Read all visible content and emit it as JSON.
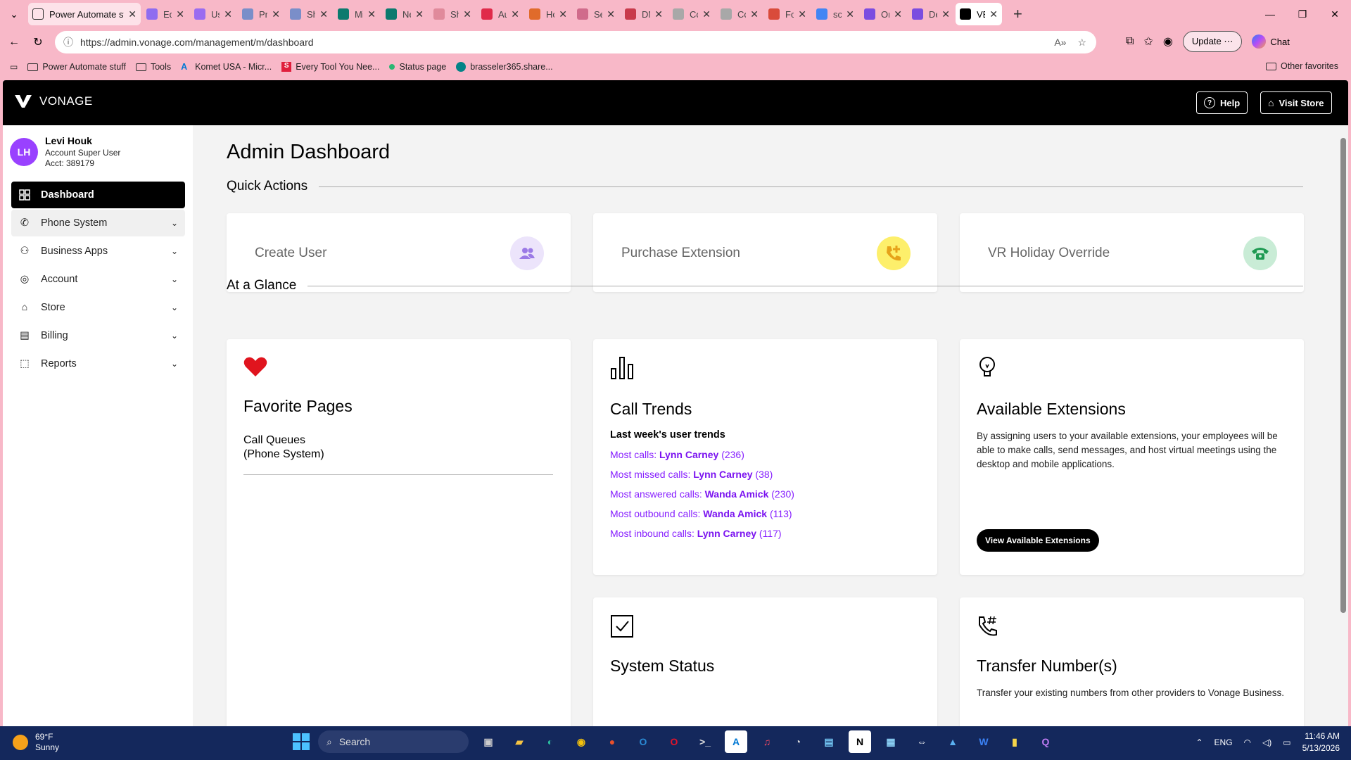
{
  "browser": {
    "tabs": [
      {
        "label": "Power Automate stuff",
        "color": "#ffffff"
      },
      {
        "label": "Edit",
        "color": "#8f6cf0"
      },
      {
        "label": "User",
        "color": "#9a6cf0"
      },
      {
        "label": "Pron",
        "color": "#7a8ec9"
      },
      {
        "label": "Shar",
        "color": "#7a8ec9"
      },
      {
        "label": "Micr",
        "color": "#0b7a6e"
      },
      {
        "label": "New",
        "color": "#0b7a6e"
      },
      {
        "label": "Shar",
        "color": "#e08a9b"
      },
      {
        "label": "Auto",
        "color": "#e02b4a"
      },
      {
        "label": "Hou",
        "color": "#e06b2b"
      },
      {
        "label": "Serv",
        "color": "#d06b8b"
      },
      {
        "label": "DM-",
        "color": "#c83a4b"
      },
      {
        "label": "Cont",
        "color": "#a8a8a8"
      },
      {
        "label": "Cont",
        "color": "#a8a8a8"
      },
      {
        "label": "Forti",
        "color": "#d94b3b"
      },
      {
        "label": "scrib",
        "color": "#4285f4"
      },
      {
        "label": "Onb",
        "color": "#7b4ce0"
      },
      {
        "label": "Desk",
        "color": "#7b4ce0"
      },
      {
        "label": "VBC",
        "color": "#000000"
      }
    ],
    "url": "https://admin.vonage.com/management/m/dashboard",
    "update_label": "Update",
    "chat_label": "Chat",
    "bookmarks": [
      "Power Automate stuff",
      "Tools",
      "Komet USA - Micr...",
      "Every Tool You Nee...",
      "Status page",
      "brasseler365.share..."
    ],
    "other_favorites": "Other favorites"
  },
  "header": {
    "brand": "VONAGE",
    "help_label": "Help",
    "store_label": "Visit Store"
  },
  "user": {
    "initials": "LH",
    "name": "Levi Houk",
    "role": "Account Super User",
    "account": "Acct: 389179"
  },
  "sidebar": {
    "items": [
      {
        "label": "Dashboard"
      },
      {
        "label": "Phone System"
      },
      {
        "label": "Business Apps"
      },
      {
        "label": "Account"
      },
      {
        "label": "Store"
      },
      {
        "label": "Billing"
      },
      {
        "label": "Reports"
      }
    ]
  },
  "main": {
    "title": "Admin Dashboard",
    "quick_actions_title": "Quick Actions",
    "quick_actions": [
      {
        "label": "Create User",
        "icon": "users-icon",
        "color": "#ece4fb"
      },
      {
        "label": "Purchase Extension",
        "icon": "phone-add-icon",
        "color": "#fdef6b"
      },
      {
        "label": "VR Holiday Override",
        "icon": "phone-icon",
        "color": "#c9ecd6"
      }
    ],
    "glance_title": "At a Glance",
    "favorites": {
      "title": "Favorite Pages",
      "item_name": "Call Queues",
      "item_section": "(Phone System)"
    },
    "call_trends": {
      "title": "Call Trends",
      "subtitle": "Last week's user trends",
      "rows": [
        {
          "label": "Most calls:",
          "name": "Lynn Carney",
          "count": "(236)"
        },
        {
          "label": "Most missed calls:",
          "name": "Lynn Carney",
          "count": "(38)"
        },
        {
          "label": "Most answered calls:",
          "name": "Wanda Amick",
          "count": "(230)"
        },
        {
          "label": "Most outbound calls:",
          "name": "Wanda Amick",
          "count": "(113)"
        },
        {
          "label": "Most inbound calls:",
          "name": "Lynn Carney",
          "count": "(117)"
        }
      ]
    },
    "extensions": {
      "title": "Available Extensions",
      "desc": "By assigning users to your available extensions, your employees will be able to make calls, send messages, and host virtual meetings using the desktop and mobile applications.",
      "button": "View Available Extensions"
    },
    "system_status": {
      "title": "System Status"
    },
    "transfer": {
      "title": "Transfer Number(s)",
      "desc": "Transfer your existing numbers from other providers to Vonage Business."
    }
  },
  "taskbar": {
    "temp": "69°F",
    "weather": "Sunny",
    "search": "Search",
    "lang": "ENG",
    "time": "11:46 AM",
    "date": "5/13/2026"
  }
}
